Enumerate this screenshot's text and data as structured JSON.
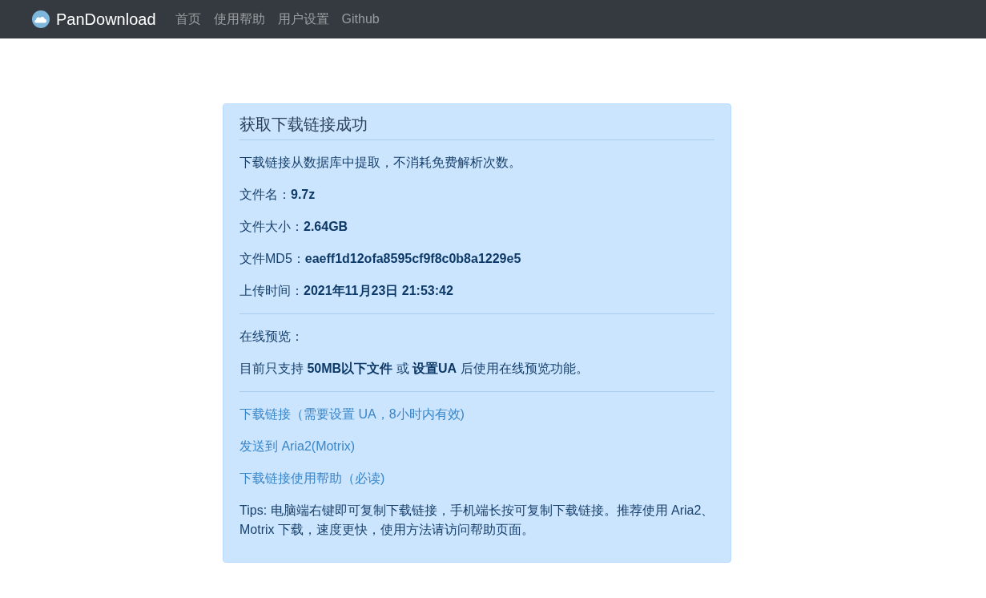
{
  "navbar": {
    "brand": "PanDownload",
    "links": [
      {
        "label": "首页"
      },
      {
        "label": "使用帮助"
      },
      {
        "label": "用户设置"
      },
      {
        "label": "Github"
      }
    ]
  },
  "alert": {
    "title": "获取下载链接成功",
    "notice": "下载链接从数据库中提取，不消耗免费解析次数。",
    "fields": [
      {
        "label": "文件名：",
        "value": "9.7z"
      },
      {
        "label": "文件大小：",
        "value": "2.64GB"
      },
      {
        "label": "文件MD5：",
        "value": "eaeff1d12ofa8595cf9f8c0b8a1229e5"
      },
      {
        "label": "上传时间：",
        "value": "2021年11月23日 21:53:42"
      }
    ],
    "preview_heading": "在线预览：",
    "preview_note": "目前只支持 **50MB以下文件** 或 **设置UA** 后使用在线预览功能。",
    "links": [
      {
        "label": "下载链接（需要设置 UA，8小时内有效)"
      },
      {
        "label": "发送到 Aria2(Motrix)"
      },
      {
        "label": "下载链接使用帮助（必读)"
      }
    ],
    "tips": "Tips: 电脑端右键即可复制下载链接，手机端长按可复制下载链接。推荐使用 Aria2、Motrix 下载，速度更快，使用方法请访问帮助页面。"
  }
}
